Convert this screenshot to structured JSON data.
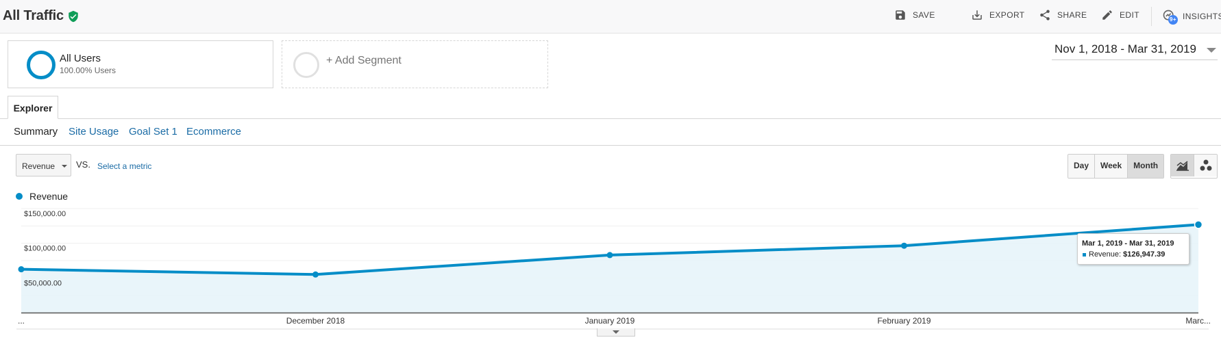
{
  "header": {
    "title": "All Traffic",
    "actions": [
      {
        "label": "SAVE",
        "icon": "save-icon"
      },
      {
        "label": "EXPORT",
        "icon": "export-icon"
      },
      {
        "label": "SHARE",
        "icon": "share-icon"
      },
      {
        "label": "EDIT",
        "icon": "edit-icon"
      },
      {
        "label": "INSIGHTS",
        "icon": "insights-icon",
        "badge": "9+"
      }
    ]
  },
  "segments": {
    "active": {
      "name": "All Users",
      "percent": "100.00% Users"
    },
    "add_label": "+ Add Segment"
  },
  "date_range": "Nov 1, 2018 - Mar 31, 2019",
  "tabs": {
    "explorer": "Explorer"
  },
  "subtabs": [
    "Summary",
    "Site Usage",
    "Goal Set 1",
    "Ecommerce"
  ],
  "controls": {
    "metric": "Revenue",
    "vs": "VS.",
    "select_metric": "Select a metric",
    "periods": [
      "Day",
      "Week",
      "Month"
    ],
    "active_period": "Month"
  },
  "colors": {
    "accent": "#058dc7",
    "fill": "#e5f3f9",
    "link": "#1a6ba5"
  },
  "legend": {
    "label": "Revenue"
  },
  "tooltip": {
    "title": "Mar 1, 2019 - Mar 31, 2019",
    "label": "Revenue:",
    "value": "$126,947.39"
  },
  "chart_data": {
    "type": "area",
    "series": [
      {
        "name": "Revenue",
        "values": [
          62500,
          55000,
          83000,
          96500,
          126947.39
        ]
      }
    ],
    "x": [
      "Nov 2018",
      "Dec 2018",
      "Jan 2019",
      "Feb 2019",
      "Mar 2019"
    ],
    "x_tick_labels": [
      "...",
      "December 2018",
      "January 2019",
      "February 2019",
      "Marc..."
    ],
    "y_tick_labels": [
      "$150,000.00",
      "$100,000.00",
      "$50,000.00"
    ],
    "y_ticks": [
      150000,
      100000,
      50000
    ],
    "ylim": [
      0,
      150000
    ],
    "grid": true
  }
}
